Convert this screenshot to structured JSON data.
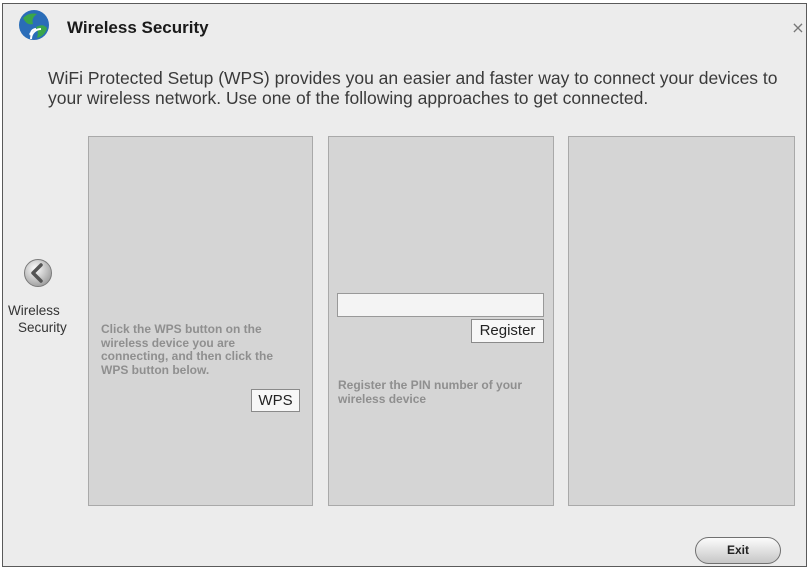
{
  "dialog": {
    "title": "Wireless Security",
    "close_glyph": "×",
    "icon": "wireless-globe-icon",
    "intro": "WiFi Protected Setup (WPS) provides you an easier and faster way to connect your devices to your wireless network. Use one of the following approaches to get connected."
  },
  "back_nav": {
    "icon": "chevron-left-icon",
    "label_line1": "Wireless",
    "label_line2": "Security"
  },
  "wps_panel": {
    "instructions": "Click the WPS button on the wireless device you are connecting, and then click the WPS button below.",
    "button_label": "WPS"
  },
  "pin_panel": {
    "input_value": "",
    "button_label": "Register",
    "instructions": "Register the PIN number of your wireless device"
  },
  "footer": {
    "exit_label": "Exit"
  },
  "colors": {
    "dialog_bg": "#ececec",
    "panel_bg": "#d5d5d5",
    "panel_text": "#8f8f8f",
    "icon_green": "#3aa64a",
    "icon_blue": "#2a6db8"
  }
}
